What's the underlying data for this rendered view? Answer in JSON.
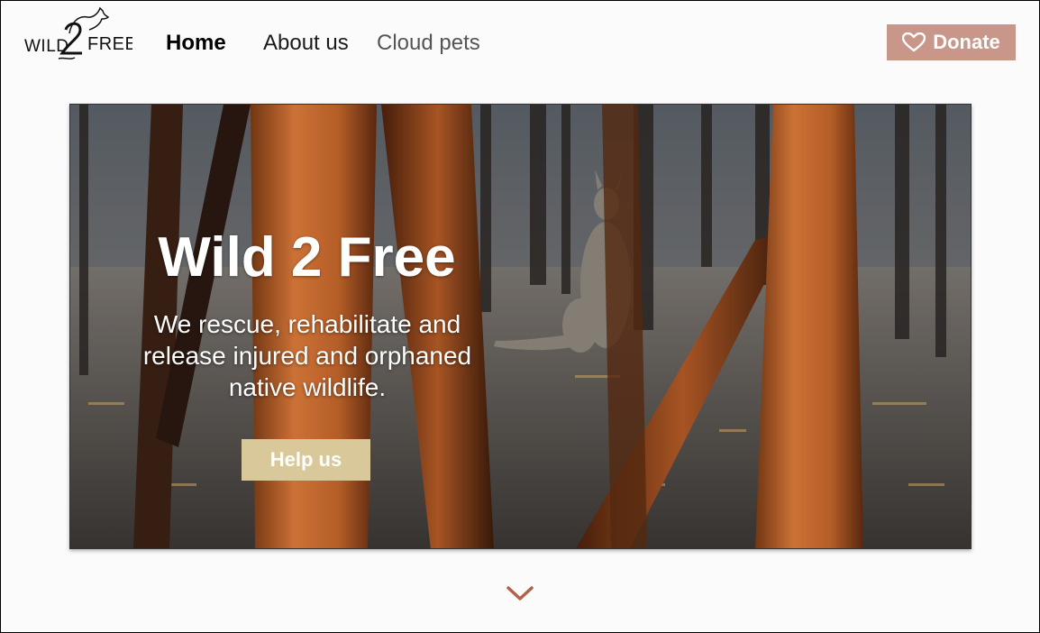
{
  "header": {
    "logo_text": "WILD 2 FREE",
    "nav": [
      {
        "label": "Home",
        "active": true
      },
      {
        "label": "About us"
      },
      {
        "label": "Cloud pets"
      }
    ],
    "donate_label": "Donate",
    "donate_icon": "heart-icon"
  },
  "hero": {
    "title": "Wild 2 Free",
    "text": "We rescue, rehabilitate and release injured and orphaned native wildlife.",
    "button_label": "Help us",
    "image": "kangaroo-in-burnt-forest"
  },
  "scroll_icon": "chevron-down-icon",
  "colors": {
    "donate_bg": "#c8978a",
    "help_bg": "#d9c89a",
    "chevron": "#b0634a"
  }
}
